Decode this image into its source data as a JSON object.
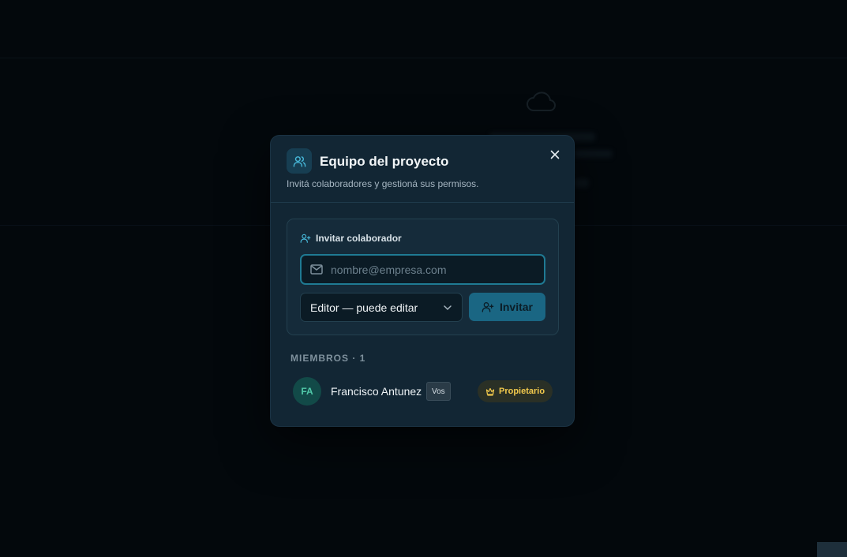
{
  "modal": {
    "title": "Equipo del proyecto",
    "subtitle": "Invitá colaboradores y gestioná sus permisos.",
    "close_icon": "close-icon",
    "header_icon": "users-icon"
  },
  "invite": {
    "label": "Invitar colaborador",
    "email_placeholder": "nombre@empresa.com",
    "email_value": "",
    "role_selected": "Editor — puede editar",
    "button_label": "Invitar"
  },
  "members": {
    "heading": "MIEMBROS · 1",
    "items": [
      {
        "initials": "FA",
        "name": "Francisco Antunez",
        "you_badge": "Vos",
        "role": "Propietario"
      }
    ]
  },
  "colors": {
    "accent": "#1f7a93",
    "button": "#1a6683",
    "owner_badge_text": "#f2c94c",
    "avatar_text": "#51c9a9"
  }
}
